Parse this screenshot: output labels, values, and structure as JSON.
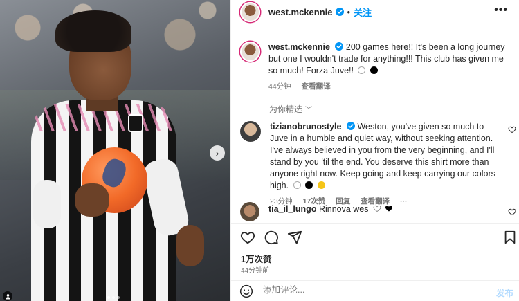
{
  "post": {
    "author": "west.mckennie",
    "follow_label": "关注",
    "more_label": "•••",
    "caption": "200 games here!! It's been a long journey but one I wouldn't trade for anything!!! This club has given me so much! Forza Juve!!",
    "caption_time": "44分钟",
    "see_translation": "查看翻译",
    "for_you_label": "为你精选",
    "likes": "1万次赞",
    "posted_time": "44分钟前",
    "comment_placeholder": "添加评论...",
    "post_label": "发布",
    "photo_next_symbol": "›"
  },
  "comments": [
    {
      "username": "tizianobrunostyle",
      "text": "Weston, you've given so much to Juve in a humble and quiet way, without seeking attention. I've always believed in you from the very beginning, and I'll stand by you 'til the end. You deserve this shirt more than anyone right now. Keep going and keep carrying our colors high.",
      "time": "23分钟",
      "likes": "17次赞",
      "reply": "回复",
      "see_translation": "查看翻译",
      "more": "···"
    },
    {
      "username": "tia_il_lungo",
      "text": "Rinnova wes"
    }
  ],
  "colors": {
    "accent": "#0095f6",
    "text": "#262626",
    "muted": "#737373",
    "post_disabled": "#b3dbff"
  }
}
